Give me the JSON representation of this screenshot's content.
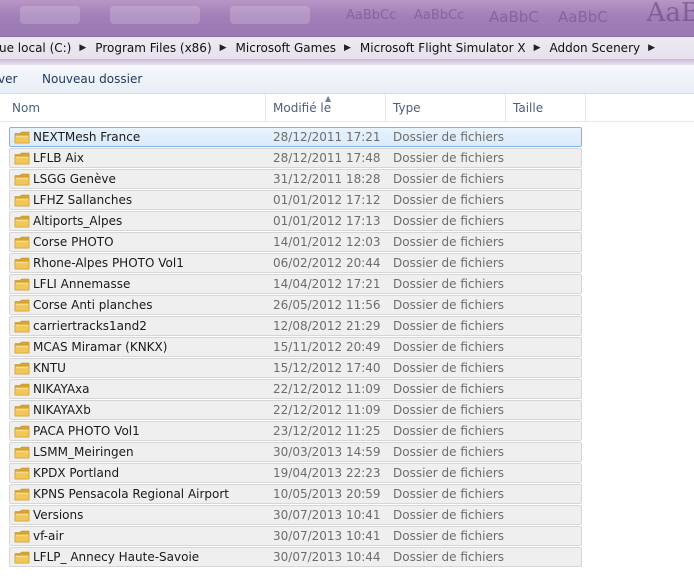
{
  "breadcrumb": {
    "items": [
      "ue local (C:)",
      "Program Files (x86)",
      "Microsoft Games",
      "Microsoft Flight Simulator X",
      "Addon Scenery"
    ]
  },
  "toolbar": {
    "partial_label": "ver",
    "new_folder_label": "Nouveau dossier"
  },
  "columns": {
    "name": "Nom",
    "modified": "Modifié le",
    "type": "Type",
    "size": "Taille"
  },
  "titlebar_text": [
    "AaBbCc",
    "AaBbCc",
    "AaBbC",
    "AaBbC",
    "AaB"
  ],
  "files": [
    {
      "name": "NEXTMesh France",
      "date": "28/12/2011 17:21",
      "type": "Dossier de fichiers",
      "selected": true
    },
    {
      "name": "LFLB Aix",
      "date": "28/12/2011 17:48",
      "type": "Dossier de fichiers"
    },
    {
      "name": "LSGG Genève",
      "date": "31/12/2011 18:28",
      "type": "Dossier de fichiers"
    },
    {
      "name": "LFHZ Sallanches",
      "date": "01/01/2012 17:12",
      "type": "Dossier de fichiers"
    },
    {
      "name": "Altiports_Alpes",
      "date": "01/01/2012 17:13",
      "type": "Dossier de fichiers"
    },
    {
      "name": "Corse PHOTO",
      "date": "14/01/2012 12:03",
      "type": "Dossier de fichiers"
    },
    {
      "name": "Rhone-Alpes PHOTO Vol1",
      "date": "06/02/2012 20:44",
      "type": "Dossier de fichiers"
    },
    {
      "name": "LFLI Annemasse",
      "date": "14/04/2012 17:21",
      "type": "Dossier de fichiers"
    },
    {
      "name": "Corse Anti planches",
      "date": "26/05/2012 11:56",
      "type": "Dossier de fichiers"
    },
    {
      "name": "carriertracks1and2",
      "date": "12/08/2012 21:29",
      "type": "Dossier de fichiers"
    },
    {
      "name": "MCAS Miramar (KNKX)",
      "date": "15/11/2012 20:49",
      "type": "Dossier de fichiers"
    },
    {
      "name": "KNTU",
      "date": "15/12/2012 17:40",
      "type": "Dossier de fichiers"
    },
    {
      "name": "NIKAYAxa",
      "date": "22/12/2012 11:09",
      "type": "Dossier de fichiers"
    },
    {
      "name": "NIKAYAXb",
      "date": "22/12/2012 11:09",
      "type": "Dossier de fichiers"
    },
    {
      "name": "PACA PHOTO Vol1",
      "date": "23/12/2012 11:25",
      "type": "Dossier de fichiers"
    },
    {
      "name": "LSMM_Meiringen",
      "date": "30/03/2013 14:59",
      "type": "Dossier de fichiers"
    },
    {
      "name": "KPDX Portland",
      "date": "19/04/2013 22:23",
      "type": "Dossier de fichiers"
    },
    {
      "name": "KPNS Pensacola Regional Airport",
      "date": "10/05/2013 20:59",
      "type": "Dossier de fichiers"
    },
    {
      "name": "Versions",
      "date": "30/07/2013 10:41",
      "type": "Dossier de fichiers"
    },
    {
      "name": "vf-air",
      "date": "30/07/2013 10:41",
      "type": "Dossier de fichiers"
    },
    {
      "name": "LFLP_ Annecy Haute-Savoie",
      "date": "30/07/2013 10:44",
      "type": "Dossier de fichiers"
    }
  ],
  "icons": {
    "folder": "folder-icon",
    "breadcrumb_separator": "chevron-right-icon",
    "sort": "sort-ascending-icon"
  },
  "colors": {
    "titlebar": "#a27fb8",
    "selection": "#d9ebfb",
    "selection_border": "#83b4e6",
    "row_bg": "#efefef",
    "folder": "#e8b84b"
  }
}
